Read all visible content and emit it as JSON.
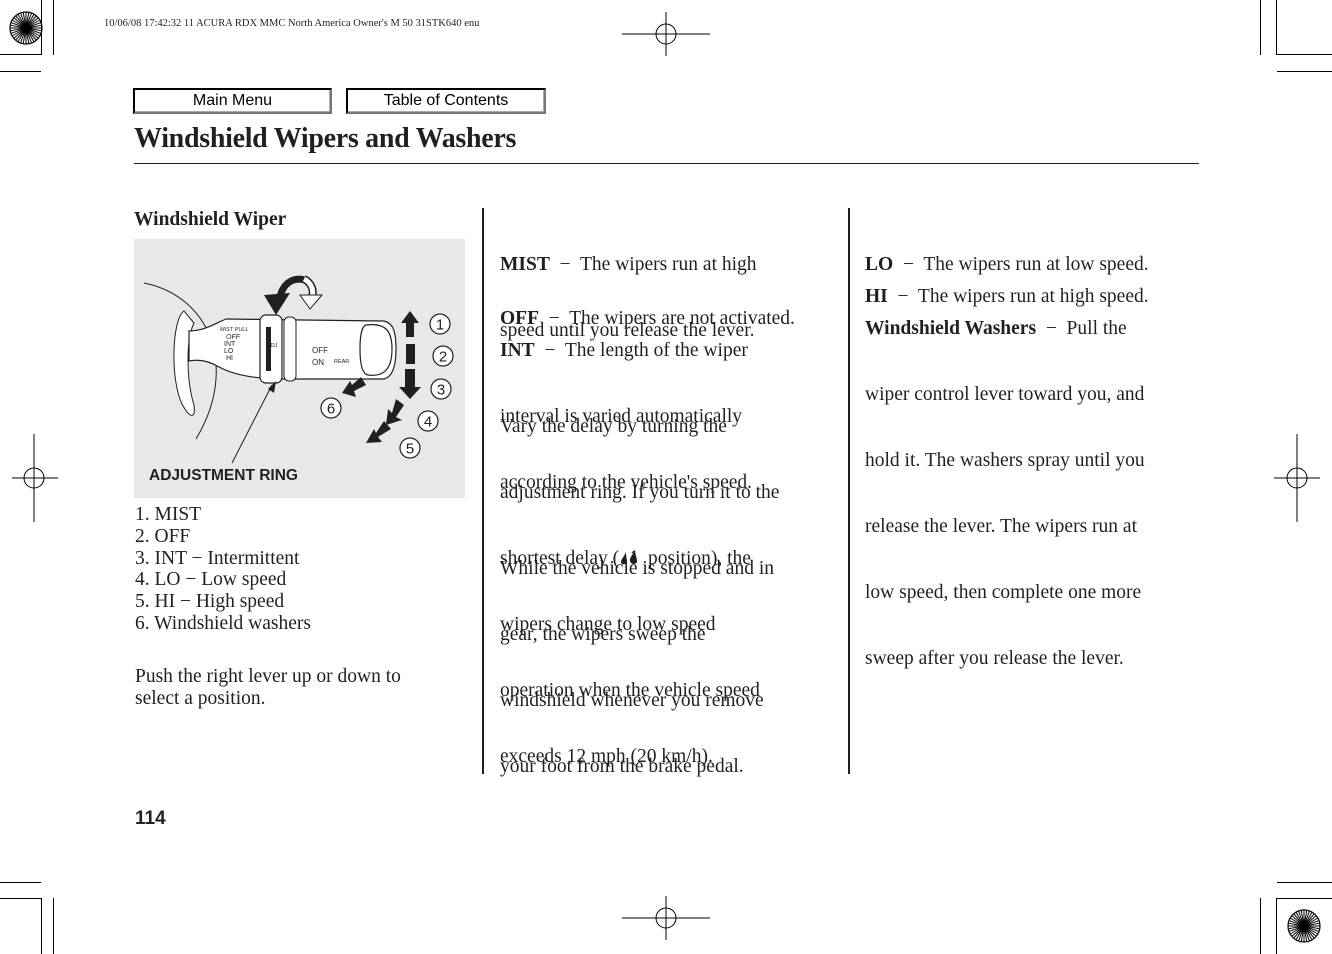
{
  "print_header": "10/06/08 17:42:32    11 ACURA RDX MMC North America Owner's M 50 31STK640 enu",
  "nav": {
    "main_menu": "Main Menu",
    "table_of_contents": "Table of Contents"
  },
  "page_title": "Windshield Wipers and Washers",
  "left_column": {
    "section_heading": "Windshield Wiper",
    "figure": {
      "label": "ADJUSTMENT RING",
      "callouts": [
        "1",
        "2",
        "3",
        "4",
        "5",
        "6"
      ],
      "lever_left_labels": [
        "MIST",
        "PULL",
        "OFF",
        "INT",
        "LO",
        "HI"
      ],
      "lever_ring_label": "ADJ",
      "lever_right_labels": [
        "OFF",
        "ON",
        "REAR"
      ]
    },
    "positions": [
      "1. MIST",
      "2. OFF",
      "3. INT  −  Intermittent",
      "4. LO  −  Low speed",
      "5. HI  −  High speed",
      "6. Windshield washers"
    ],
    "instruction": [
      "Push the right lever up or down to",
      "select a position."
    ]
  },
  "middle_column": {
    "mist": {
      "term": "MIST",
      "lines": [
        "  −  The wipers run at high",
        "speed until you release the lever."
      ]
    },
    "off": {
      "term": "OFF",
      "lines": [
        "  −  The wipers are not activated."
      ]
    },
    "int": {
      "term": "INT",
      "lines": [
        "  −  The length of the wiper",
        "interval is varied automatically",
        "according to the vehicle's speed."
      ]
    },
    "vary": {
      "line1": "Vary the delay by turning the",
      "line2": "adjustment ring. If you turn it to the",
      "line3_pre": "shortest delay (",
      "line3_icon": "double-raindrop-icon",
      "line3_post": " position), the",
      "line4": "wipers change to low speed",
      "line5": "operation when the vehicle speed",
      "line6": "exceeds 12 mph (20 km/h)."
    },
    "stopped": [
      "While the vehicle is stopped and in",
      "gear, the wipers sweep the",
      "windshield whenever you remove",
      "your foot from the brake pedal."
    ]
  },
  "right_column": {
    "lo": {
      "term": "LO",
      "lines": [
        "  −  The wipers run at low speed."
      ]
    },
    "hi": {
      "term": "HI",
      "lines": [
        "  −  The wipers run at high speed."
      ]
    },
    "washers": {
      "term": "Windshield Washers",
      "first": "  −  Pull the",
      "lines": [
        "wiper control lever toward you, and",
        "hold it. The washers spray until you",
        "release the lever. The wipers run at",
        "low speed, then complete one more",
        "sweep after you release the lever."
      ]
    }
  },
  "page_number": "114"
}
